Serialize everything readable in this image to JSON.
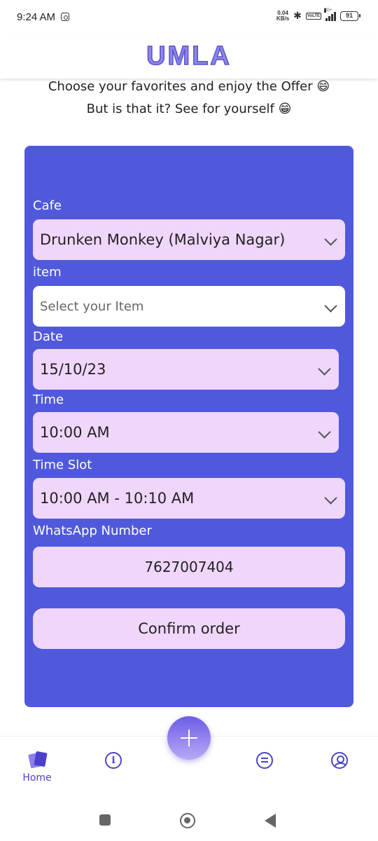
{
  "status_bar": {
    "time": "9:24 AM",
    "net_speed_value": "0.04",
    "net_speed_unit": "KB/s",
    "network_type": "5G+",
    "volte": "VoLTE",
    "battery": "91"
  },
  "header": {
    "logo": "UMLA"
  },
  "intro": {
    "line1": "Choose your favorites and enjoy the Offer 😄",
    "line2": "But is that it? See for yourself 😁"
  },
  "form": {
    "cafe_label": "Cafe",
    "cafe_value": "Drunken Monkey (Malviya Nagar)",
    "item_label": "item",
    "item_placeholder": "Select your Item",
    "date_label": "Date",
    "date_value": "15/10/23",
    "time_label": "Time",
    "time_value": "10:00 AM",
    "slot_label": "Time Slot",
    "slot_value": "10:00 AM - 10:10 AM",
    "whatsapp_label": "WhatsApp Number",
    "whatsapp_value": "7627007404",
    "confirm_label": "Confirm order"
  },
  "bottom_nav": {
    "home_label": "Home",
    "icons": [
      "home-cards-icon",
      "info-icon",
      "add-icon",
      "chat-icon",
      "profile-icon"
    ],
    "accent_color": "#4b45c8"
  },
  "colors": {
    "card_bg": "#5059dc",
    "field_bg": "#f0d6fb",
    "logo": "#8e86e6"
  }
}
